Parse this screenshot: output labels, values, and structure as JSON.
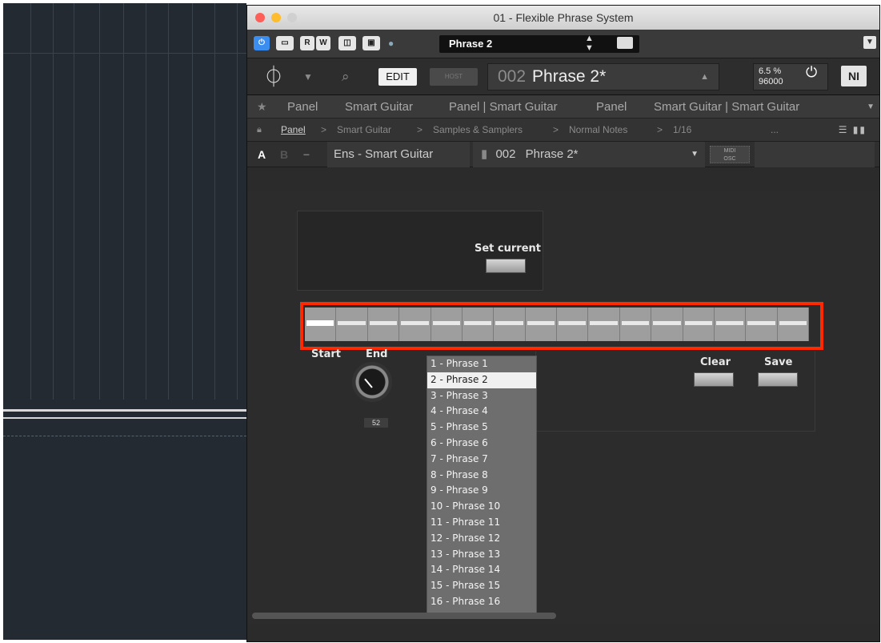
{
  "window": {
    "title": "01 - Flexible Phrase System"
  },
  "hostbar": {
    "preset_name": "Phrase 2",
    "btn_r": "R",
    "btn_w": "W"
  },
  "kontakt": {
    "edit_label": "EDIT",
    "save_label": "HOST",
    "preset_number": "002",
    "preset_name": "Phrase 2*",
    "cpu_percent": "6.5 %",
    "sample_rate": "96000",
    "ni_logo": "NI"
  },
  "favorites": [
    "Panel",
    "Smart Guitar",
    "Panel | Smart Guitar",
    "Panel",
    "Smart Guitar | Smart Guitar"
  ],
  "breadcrumb": [
    "Panel",
    "Smart Guitar",
    "Samples & Samplers",
    "Normal Notes",
    "1/16",
    "..."
  ],
  "instrument": {
    "slot_a": "A",
    "slot_b": "B",
    "minus": "−",
    "ensemble_name": "Ens - Smart Guitar",
    "program_number": "002",
    "program_name": "Phrase 2*",
    "midi_label_1": "MIDI",
    "midi_label_2": "OSC"
  },
  "panel": {
    "set_current_label": "Set current",
    "start_label": "Start",
    "end_label": "End",
    "knob_value": "52",
    "clear_label": "Clear",
    "save_label": "Save",
    "step_count": 16,
    "selected_step": 1,
    "phrases": [
      "1 - Phrase 1",
      "2 - Phrase 2",
      "3 - Phrase 3",
      "4 - Phrase 4",
      "5 - Phrase 5",
      "6 - Phrase 6",
      "7 - Phrase 7",
      "8 - Phrase 8",
      "9 - Phrase 9",
      "10 - Phrase 10",
      "11 - Phrase 11",
      "12 - Phrase 12",
      "13 - Phrase 13",
      "14 - Phrase 14",
      "15 - Phrase 15",
      "16 - Phrase 16"
    ],
    "selected_phrase_index": 1
  },
  "colors": {
    "highlight": "#ff2a00",
    "panel_bg": "#2c2c2c",
    "list_bg": "#6e6e6e"
  }
}
